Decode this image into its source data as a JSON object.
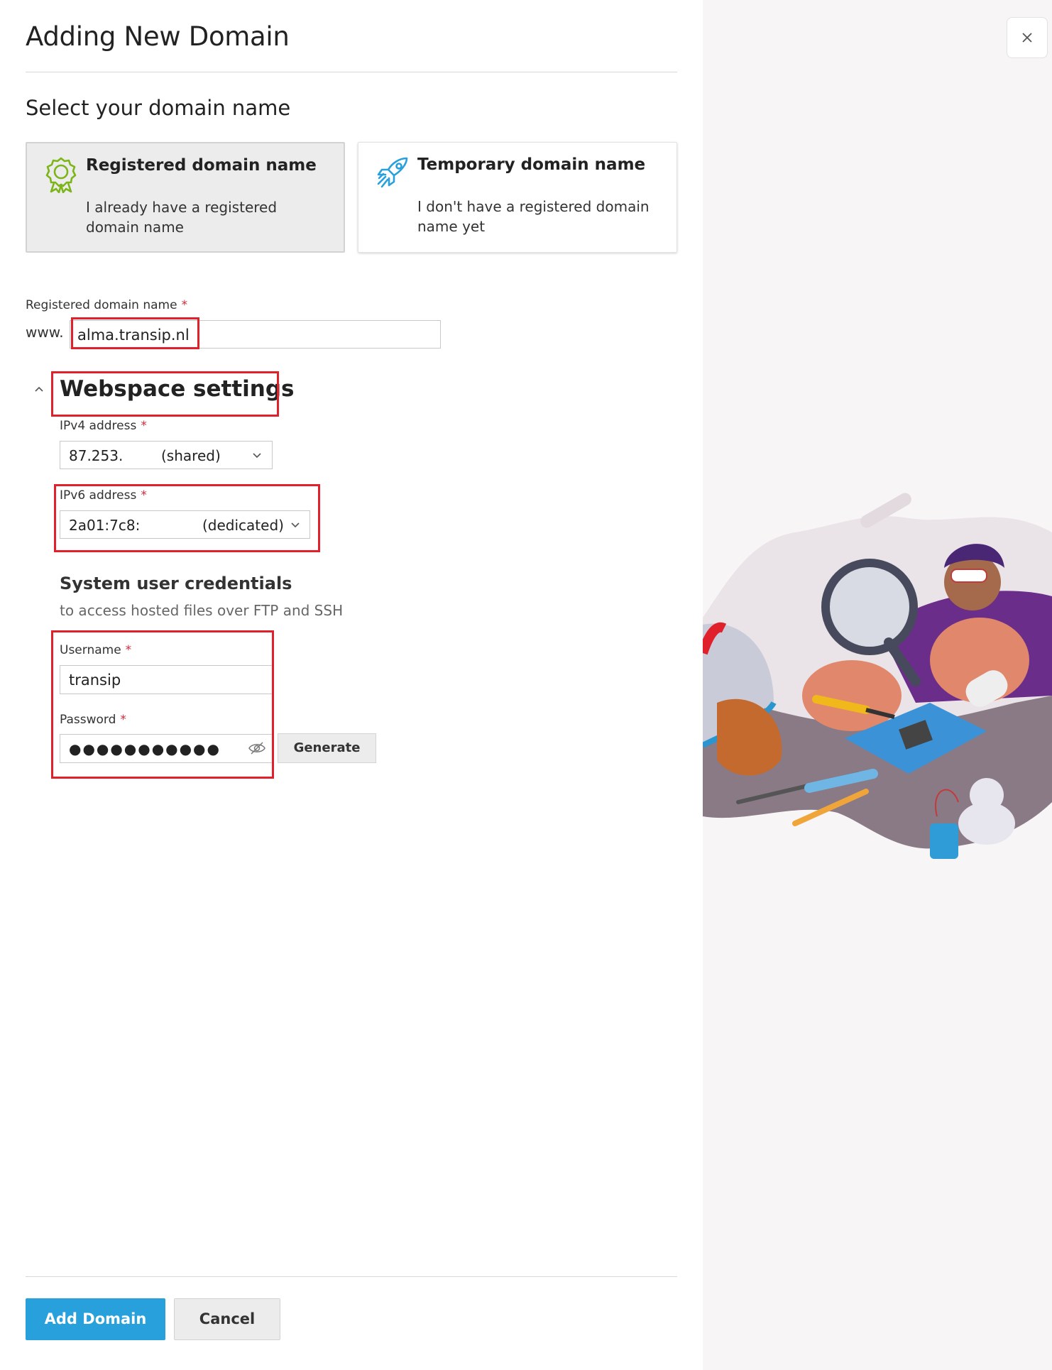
{
  "dialog": {
    "title": "Adding New Domain"
  },
  "domain_selection": {
    "heading": "Select your domain name",
    "options": [
      {
        "title": "Registered domain name",
        "description": "I already have a registered domain name",
        "icon": "award-badge-icon",
        "selected": true
      },
      {
        "title": "Temporary domain name",
        "description": "I don't have a registered domain name yet",
        "icon": "rocket-icon",
        "selected": false
      }
    ]
  },
  "registered_domain": {
    "label": "Registered domain name",
    "required_mark": "*",
    "prefix": "www.",
    "value": "alma.transip.nl"
  },
  "webspace": {
    "title": "Webspace settings",
    "ipv4": {
      "label": "IPv4 address",
      "value": "87.253.",
      "type": "(shared)"
    },
    "ipv6": {
      "label": "IPv6 address",
      "value": "2a01:7c8:",
      "type": "(dedicated)"
    }
  },
  "credentials": {
    "title": "System user credentials",
    "subtitle": "to access hosted files over FTP and SSH",
    "username_label": "Username",
    "username_value": "transip",
    "password_label": "Password",
    "password_mask": "●●●●●●●●●●●",
    "generate_label": "Generate"
  },
  "footer": {
    "add_label": "Add Domain",
    "cancel_label": "Cancel"
  },
  "colors": {
    "primary": "#28a0dc",
    "required": "#d02b3a",
    "highlight": "#e0212b",
    "badge_green": "#7cb518"
  }
}
